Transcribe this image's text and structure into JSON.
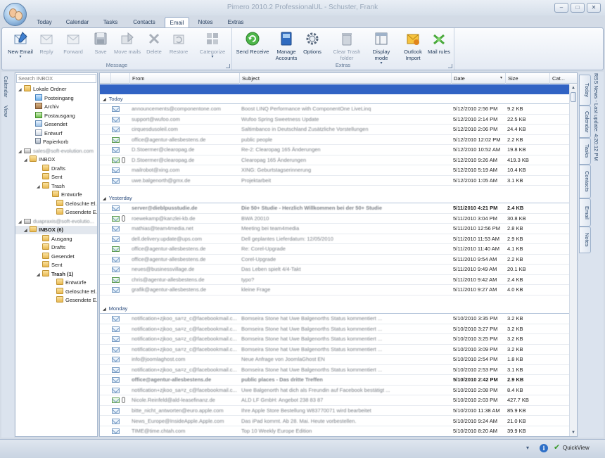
{
  "window": {
    "title": "Pimero 2010.2 ProfessionalUL - Schuster, Frank",
    "buttons": [
      "–",
      "□",
      "✕"
    ]
  },
  "ribbon_tabs": [
    {
      "label": "Today",
      "active": false
    },
    {
      "label": "Calendar",
      "active": false
    },
    {
      "label": "Tasks",
      "active": false
    },
    {
      "label": "Contacts",
      "active": false
    },
    {
      "label": "Email",
      "active": true
    },
    {
      "label": "Notes",
      "active": false
    },
    {
      "label": "Extras",
      "active": false
    }
  ],
  "ribbon": {
    "groups": {
      "message": "Message",
      "extras": "Extras"
    },
    "buttons": {
      "new_email": "New Email",
      "reply": "Reply",
      "forward": "Forward",
      "save": "Save",
      "move_mails": "Move mails",
      "delete": "Delete",
      "restore": "Restore",
      "categorize": "Categorize",
      "send_receive": "Send Receive",
      "manage_accounts": "Manage Accounts",
      "options": "Options",
      "clear_trash": "Clear Trash folder",
      "display_mode": "Display mode",
      "outlook_import": "Outlook Import",
      "mail_rules": "Mail rules"
    },
    "dropdown_glyph": "▾"
  },
  "left_strip": {
    "calendar": "Calendar",
    "view": "View"
  },
  "right_strip": {
    "rss": "RSS News - Last update: 4:20:12 PM",
    "tabs": [
      "Today",
      "Calendar",
      "Tasks",
      "Contacts",
      "Email",
      "Notes"
    ]
  },
  "folder_pane": {
    "search_placeholder": "Search INBOX",
    "nodes": [
      {
        "label": "Lokale Ordner",
        "toggle": "◢",
        "icon": "folder",
        "bold": false,
        "blur": false,
        "selected": false
      },
      {
        "label": "Posteingang",
        "toggle": "",
        "icon": "inbox",
        "bold": false,
        "blur": false,
        "selected": false
      },
      {
        "label": "Archiv",
        "toggle": "",
        "icon": "archive",
        "bold": false,
        "blur": false,
        "selected": false
      },
      {
        "label": "Postausgang",
        "toggle": "",
        "icon": "outbox",
        "bold": false,
        "blur": false,
        "selected": false
      },
      {
        "label": "Gesendet",
        "toggle": "",
        "icon": "sent",
        "bold": false,
        "blur": false,
        "selected": false
      },
      {
        "label": "Entwurf",
        "toggle": "",
        "icon": "draft",
        "bold": false,
        "blur": false,
        "selected": false
      },
      {
        "label": "Papierkorb",
        "toggle": "",
        "icon": "trash",
        "bold": false,
        "blur": false,
        "selected": false
      },
      {
        "label": "sales@soft-evolution.com",
        "toggle": "◢",
        "icon": "server",
        "bold": false,
        "blur": true,
        "selected": false
      },
      {
        "label": "INBOX",
        "toggle": "◢",
        "icon": "folder",
        "bold": false,
        "blur": false,
        "selected": false
      },
      {
        "label": "Drafts",
        "toggle": "",
        "icon": "folder",
        "bold": false,
        "blur": false,
        "selected": false
      },
      {
        "label": "Sent",
        "toggle": "",
        "icon": "folder",
        "bold": false,
        "blur": false,
        "selected": false
      },
      {
        "label": "Trash",
        "toggle": "◢",
        "icon": "folder",
        "bold": false,
        "blur": false,
        "selected": false
      },
      {
        "label": "Entwürfe",
        "toggle": "",
        "icon": "folder",
        "bold": false,
        "blur": false,
        "selected": false
      },
      {
        "label": "Gelöschte El...",
        "toggle": "",
        "icon": "folder",
        "bold": false,
        "blur": false,
        "selected": false
      },
      {
        "label": "Gesendete E...",
        "toggle": "",
        "icon": "folder",
        "bold": false,
        "blur": false,
        "selected": false
      },
      {
        "label": "duapraxis@soft-evolutio...",
        "toggle": "◢",
        "icon": "server",
        "bold": false,
        "blur": true,
        "selected": false
      },
      {
        "label": "INBOX (6)",
        "toggle": "◢",
        "icon": "folder",
        "bold": true,
        "blur": false,
        "selected": true
      },
      {
        "label": "Ausgang",
        "toggle": "",
        "icon": "folder",
        "bold": false,
        "blur": false,
        "selected": false
      },
      {
        "label": "Drafts",
        "toggle": "",
        "icon": "folder",
        "bold": false,
        "blur": false,
        "selected": false
      },
      {
        "label": "Gesendet",
        "toggle": "",
        "icon": "folder",
        "bold": false,
        "blur": false,
        "selected": false
      },
      {
        "label": "Sent",
        "toggle": "",
        "icon": "folder",
        "bold": false,
        "blur": false,
        "selected": false
      },
      {
        "label": "Trash (1)",
        "toggle": "◢",
        "icon": "folder",
        "bold": true,
        "blur": false,
        "selected": false
      },
      {
        "label": "Entwürfe",
        "toggle": "",
        "icon": "folder",
        "bold": false,
        "blur": false,
        "selected": false
      },
      {
        "label": "Gelöschte El...",
        "toggle": "",
        "icon": "folder",
        "bold": false,
        "blur": false,
        "selected": false
      },
      {
        "label": "Gesendete E...",
        "toggle": "",
        "icon": "folder",
        "bold": false,
        "blur": false,
        "selected": false
      }
    ]
  },
  "mail_list": {
    "columns": [
      "From",
      "Subject",
      "Date",
      "Size",
      "Cat..."
    ],
    "sort_glyph": "▾",
    "group_glyph": "◢",
    "groups": [
      {
        "label": "Today",
        "rows": [
          {
            "from": "announcements@componentone.com",
            "subject": "Boost LINQ Performance with ComponentOne LiveLinq",
            "date": "5/12/2010 2:56 PM",
            "size": "9.2 KB",
            "unread": false,
            "replied": false,
            "attachment": false
          },
          {
            "from": "support@wufoo.com",
            "subject": "Wufoo Spring Sweetness Update",
            "date": "5/12/2010 2:14 PM",
            "size": "22.5 KB",
            "unread": false,
            "replied": false,
            "attachment": false
          },
          {
            "from": "cirquesdusoleil.com",
            "subject": "Saltimbanco in Deutschland     Zusätzliche Vorstellungen",
            "date": "5/12/2010 2:06 PM",
            "size": "24.4 KB",
            "unread": false,
            "replied": false,
            "attachment": false
          },
          {
            "from": "office@agentur-allesbestens.de",
            "subject": "public people",
            "date": "5/12/2010 12:02 PM",
            "size": "2.2 KB",
            "unread": false,
            "replied": true,
            "attachment": false
          },
          {
            "from": "D.Stoermer@clearopag.de",
            "subject": "Re-2: Clearopag 165 Änderungen",
            "date": "5/12/2010 10:52 AM",
            "size": "19.8 KB",
            "unread": false,
            "replied": false,
            "attachment": false
          },
          {
            "from": "D.Stoermer@clearopag.de",
            "subject": "Clearopag 165 Änderungen",
            "date": "5/12/2010 9:26 AM",
            "size": "419.3 KB",
            "unread": false,
            "replied": true,
            "attachment": true
          },
          {
            "from": "mailrobot@xing.com",
            "subject": "XING: Geburtstagserinnerung",
            "date": "5/12/2010 5:19 AM",
            "size": "10.4 KB",
            "unread": false,
            "replied": false,
            "attachment": false
          },
          {
            "from": "uwe.balgenorth@gmx.de",
            "subject": "Projektarbeit",
            "date": "5/12/2010 1:05 AM",
            "size": "3.1 KB",
            "unread": false,
            "replied": false,
            "attachment": false
          }
        ]
      },
      {
        "label": "Yesterday",
        "rows": [
          {
            "from": "server@dieblpusstudie.de",
            "subject": "Die 50+ Studie - Herzlich Willkommen bei der 50+ Studie",
            "date": "5/11/2010 4:21 PM",
            "size": "2.4 KB",
            "unread": true,
            "replied": false,
            "attachment": false
          },
          {
            "from": "roewekamp@kanzlei-kb.de",
            "subject": "BWA 20010",
            "date": "5/11/2010 3:04 PM",
            "size": "30.8 KB",
            "unread": false,
            "replied": true,
            "attachment": true
          },
          {
            "from": "mathias@team4media.net",
            "subject": "Meeting bei team4media",
            "date": "5/11/2010 12:56 PM",
            "size": "2.8 KB",
            "unread": false,
            "replied": false,
            "attachment": false
          },
          {
            "from": "dell.delivery.update@ups.com",
            "subject": "Dell geplantes Lieferdatum: 12/05/2010",
            "date": "5/11/2010 11:53 AM",
            "size": "2.9 KB",
            "unread": false,
            "replied": false,
            "attachment": false
          },
          {
            "from": "office@agentur-allesbestens.de",
            "subject": "Re: Corel-Upgrade",
            "date": "5/11/2010 11:40 AM",
            "size": "4.1 KB",
            "unread": false,
            "replied": true,
            "attachment": false
          },
          {
            "from": "office@agentur-allesbestens.de",
            "subject": "Corel-Upgrade",
            "date": "5/11/2010 9:54 AM",
            "size": "2.2 KB",
            "unread": false,
            "replied": false,
            "attachment": false
          },
          {
            "from": "neues@businessvillage.de",
            "subject": "Das Leben spielt 4/4-Takt",
            "date": "5/11/2010 9:49 AM",
            "size": "20.1 KB",
            "unread": false,
            "replied": false,
            "attachment": false
          },
          {
            "from": "chris@agentur-allesbestens.de",
            "subject": "typo?",
            "date": "5/11/2010 9:42 AM",
            "size": "2.4 KB",
            "unread": false,
            "replied": true,
            "attachment": false
          },
          {
            "from": "grafik@agentur-allesbestens.de",
            "subject": "kleine Frage",
            "date": "5/11/2010 9:27 AM",
            "size": "4.0 KB",
            "unread": false,
            "replied": false,
            "attachment": false
          }
        ]
      },
      {
        "label": "Monday",
        "rows": [
          {
            "from": "notification+zjkoo_sa=z_c@facebookmail.c...",
            "subject": "Bomseira Stone hat Uwe Balgenorths Status kommentiert ...",
            "date": "5/10/2010 3:35 PM",
            "size": "3.2 KB",
            "unread": false,
            "replied": false,
            "attachment": false
          },
          {
            "from": "notification+zjkoo_sa=z_c@facebookmail.c...",
            "subject": "Bomseira Stone hat Uwe Balgenorths Status kommentiert ...",
            "date": "5/10/2010 3:27 PM",
            "size": "3.2 KB",
            "unread": false,
            "replied": false,
            "attachment": false
          },
          {
            "from": "notification+zjkoo_sa=z_c@facebookmail.c...",
            "subject": "Bomseira Stone hat Uwe Balgenorths Status kommentiert ...",
            "date": "5/10/2010 3:25 PM",
            "size": "3.2 KB",
            "unread": false,
            "replied": false,
            "attachment": false
          },
          {
            "from": "notification+zjkoo_sa=z_c@facebookmail.c...",
            "subject": "Bomseira Stone hat Uwe Balgenorths Status kommentiert ...",
            "date": "5/10/2010 3:09 PM",
            "size": "3.2 KB",
            "unread": false,
            "replied": false,
            "attachment": false
          },
          {
            "from": "info@joomlaghost.com",
            "subject": "Neue Anfrage von JoomlaGhost EN",
            "date": "5/10/2010 2:54 PM",
            "size": "1.8 KB",
            "unread": false,
            "replied": false,
            "attachment": false
          },
          {
            "from": "notification+zjkoo_sa=z_c@facebookmail.c...",
            "subject": "Bomseira Stone hat Uwe Balgenorths Status kommentiert ...",
            "date": "5/10/2010 2:53 PM",
            "size": "3.1 KB",
            "unread": false,
            "replied": false,
            "attachment": false
          },
          {
            "from": "office@agentur-allesbestens.de",
            "subject": "public places - Das dritte Treffen",
            "date": "5/10/2010 2:42 PM",
            "size": "2.9 KB",
            "unread": true,
            "replied": false,
            "attachment": false
          },
          {
            "from": "notification+zjkoo_sa=z_c@facebookmail.c...",
            "subject": "Uwe Balgenorth hat dich als Freundin auf Facebook bestätigt ...",
            "date": "5/10/2010 2:08 PM",
            "size": "8.4 KB",
            "unread": false,
            "replied": false,
            "attachment": false
          },
          {
            "from": "Nicole.Reinfeld@ald-leasefinanz.de",
            "subject": "ALD LF GmbH: Angebot 238 83 87",
            "date": "5/10/2010 2:03 PM",
            "size": "427.7 KB",
            "unread": false,
            "replied": true,
            "attachment": true
          },
          {
            "from": "bitte_nicht_antworten@euro.apple.com",
            "subject": "Ihre Apple Store Bestellung W83770071 wird bearbeitet",
            "date": "5/10/2010 11:38 AM",
            "size": "85.9 KB",
            "unread": false,
            "replied": false,
            "attachment": false
          },
          {
            "from": "News_Europe@InsideApple.Apple.com",
            "subject": "Das iPad kommt. Ab 28. Mai. Heute vorbestellen.",
            "date": "5/10/2010 9:24 AM",
            "size": "21.0 KB",
            "unread": false,
            "replied": false,
            "attachment": false
          },
          {
            "from": "TIME@time.chtah.com",
            "subject": "Top 10 Weekly Europe Edition",
            "date": "5/10/2010 8:20 AM",
            "size": "39.9 KB",
            "unread": false,
            "replied": false,
            "attachment": false
          }
        ]
      }
    ]
  },
  "status_bar": {
    "quickview": "QuickView",
    "info": "i",
    "arrow": "▾",
    "check": "✔"
  },
  "colors": {
    "selection": "#3163c4",
    "group_text": "#2b4c7e",
    "ribbon_border": "#a3b4cb"
  }
}
